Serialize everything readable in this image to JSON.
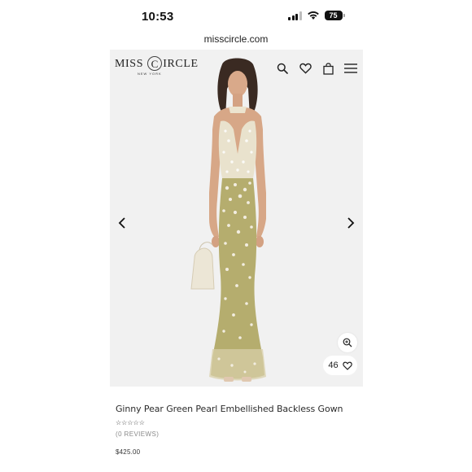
{
  "status_bar": {
    "time": "10:53",
    "battery_level": "75",
    "icons": [
      "signal-icon",
      "wifi-icon",
      "battery-icon"
    ]
  },
  "browser": {
    "url": "misscircle.com"
  },
  "header": {
    "logo_main_left": "MISS",
    "logo_main_c": "C",
    "logo_main_right": "IRCLE",
    "logo_sub": "NEW YORK",
    "icons": [
      "search-icon",
      "heart-icon",
      "shopping-bag-icon",
      "menu-icon"
    ]
  },
  "gallery": {
    "like_count": "46",
    "icons": [
      "chevron-left-icon",
      "chevron-right-icon",
      "zoom-in-icon",
      "heart-icon"
    ]
  },
  "product": {
    "title": "Ginny Pear Green Pearl Embellished Backless Gown",
    "stars": "☆☆☆☆☆",
    "reviews": "(0 REVIEWS)",
    "price": "$425.00"
  },
  "colors": {
    "gown": "#b5ad6e",
    "pearl": "#f2ede0",
    "stage_bg": "#f1f1f1",
    "hair": "#3a2a22",
    "skin": "#d9a98a"
  }
}
